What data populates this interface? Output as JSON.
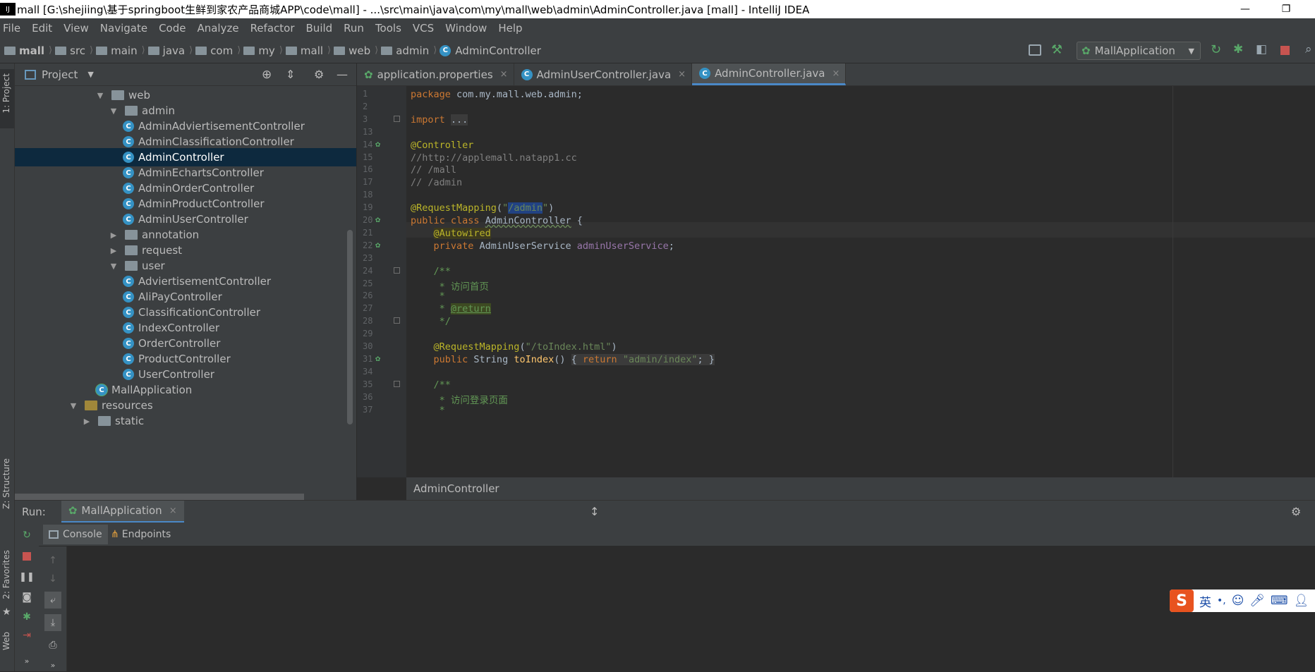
{
  "window": {
    "title": "mall [G:\\shejiing\\基于springboot生鲜到家农产品商城APP\\code\\mall] - ...\\src\\main\\java\\com\\my\\mall\\web\\admin\\AdminController.java [mall] - IntelliJ IDEA",
    "minimize": "—",
    "restore": "❐"
  },
  "menu": [
    "File",
    "Edit",
    "View",
    "Navigate",
    "Code",
    "Analyze",
    "Refactor",
    "Build",
    "Run",
    "Tools",
    "VCS",
    "Window",
    "Help"
  ],
  "breadcrumbs": [
    "mall",
    "src",
    "main",
    "java",
    "com",
    "my",
    "mall",
    "web",
    "admin",
    "AdminController"
  ],
  "run_config": "MallApplication",
  "tool_strip": {
    "project": "1: Project",
    "structure": "Z: Structure",
    "favorites": "2: Favorites",
    "web": "Web"
  },
  "project_panel": {
    "title": "Project",
    "tree": [
      {
        "label": "web",
        "type": "folder",
        "level": 1,
        "arrow": "▼"
      },
      {
        "label": "admin",
        "type": "folder",
        "level": 2,
        "arrow": "▼"
      },
      {
        "label": "AdminAdviertisementController",
        "type": "class",
        "level": 3
      },
      {
        "label": "AdminClassificationController",
        "type": "class",
        "level": 3
      },
      {
        "label": "AdminController",
        "type": "class",
        "level": 3,
        "selected": true
      },
      {
        "label": "AdminEchartsController",
        "type": "class",
        "level": 3
      },
      {
        "label": "AdminOrderController",
        "type": "class",
        "level": 3
      },
      {
        "label": "AdminProductController",
        "type": "class",
        "level": 3
      },
      {
        "label": "AdminUserController",
        "type": "class",
        "level": 3
      },
      {
        "label": "annotation",
        "type": "folder",
        "level": 2,
        "arrow": "▶"
      },
      {
        "label": "request",
        "type": "folder",
        "level": 2,
        "arrow": "▶"
      },
      {
        "label": "user",
        "type": "folder",
        "level": 2,
        "arrow": "▼"
      },
      {
        "label": "AdviertisementController",
        "type": "class",
        "level": 3
      },
      {
        "label": "AliPayController",
        "type": "class",
        "level": 3
      },
      {
        "label": "ClassificationController",
        "type": "class",
        "level": 3
      },
      {
        "label": "IndexController",
        "type": "class",
        "level": 3
      },
      {
        "label": "OrderController",
        "type": "class",
        "level": 3
      },
      {
        "label": "ProductController",
        "type": "class",
        "level": 3
      },
      {
        "label": "UserController",
        "type": "class",
        "level": 3
      },
      {
        "label": "MallApplication",
        "type": "app",
        "level": 1
      },
      {
        "label": "resources",
        "type": "resfolder",
        "level": -1,
        "arrow": "▼"
      },
      {
        "label": "static",
        "type": "folder",
        "level": 0,
        "arrow": "▶"
      }
    ]
  },
  "tabs": [
    {
      "label": "application.properties",
      "active": false
    },
    {
      "label": "AdminUserController.java",
      "active": false
    },
    {
      "label": "AdminController.java",
      "active": true
    }
  ],
  "tab_close": "×",
  "code_lines": [
    {
      "n": "1",
      "html": "<span class='k'>package</span> com.my.mall.web.admin;"
    },
    {
      "n": "2",
      "html": ""
    },
    {
      "n": "3",
      "html": "<span class='k'>import</span> <span style='background:#3b3b3b'>...</span>"
    },
    {
      "n": "13",
      "html": ""
    },
    {
      "n": "14",
      "html": "<span class='a'>@Controller</span>"
    },
    {
      "n": "15",
      "html": "<span class='c'>//http://applemall.natapp1.cc</span>"
    },
    {
      "n": "16",
      "html": "<span class='c'>// /mall</span>"
    },
    {
      "n": "17",
      "html": "<span class='c'>// /admin</span>"
    },
    {
      "n": "18",
      "html": ""
    },
    {
      "n": "19",
      "html": "<span class='a'>@RequestMapping</span>(<span class='s'>\"<span style='background:#214283'>/admin</span>\"</span>)"
    },
    {
      "n": "20",
      "html": "<span class='k'>public class</span> <span style='text-decoration:underline wavy #6a8759'>AdminController</span> {"
    },
    {
      "n": "21",
      "html": "    <span class='a' style='background:#3d3a1f'>@Autowired</span>"
    },
    {
      "n": "22",
      "html": "    <span class='k'>private</span> AdminUserService <span class='f'>adminUserService</span>;"
    },
    {
      "n": "23",
      "html": ""
    },
    {
      "n": "24",
      "html": "    <span class='d'>/**</span>"
    },
    {
      "n": "25",
      "html": "     <span class='d'>* 访问首页</span>"
    },
    {
      "n": "26",
      "html": "     <span class='d'>*</span>"
    },
    {
      "n": "27",
      "html": "     <span class='d'>* <span style='background:#3d4a22;text-decoration:underline'>@return</span></span>"
    },
    {
      "n": "28",
      "html": "     <span class='d'>*/</span>"
    },
    {
      "n": "29",
      "html": ""
    },
    {
      "n": "30",
      "html": "    <span class='a'>@RequestMapping</span>(<span class='s'>\"/toIndex.html\"</span>)"
    },
    {
      "n": "31",
      "html": "    <span class='k'>public</span> String <span class='m'>toIndex</span>() <span style='background:#3b3b3b'>{ <span class='k'>return</span> <span class='s'>\"admin/index\"</span>; }</span>"
    },
    {
      "n": "34",
      "html": ""
    },
    {
      "n": "35",
      "html": "    <span class='d'>/**</span>"
    },
    {
      "n": "36",
      "html": "     <span class='d'>* 访问登录页面</span>"
    },
    {
      "n": "37",
      "html": "     <span class='d'>*</span>"
    }
  ],
  "editor_breadcrumb": "AdminController",
  "run": {
    "label": "Run:",
    "config": "MallApplication",
    "close": "×",
    "tabs": [
      "Console",
      "Endpoints"
    ]
  },
  "ime": {
    "logo": "S",
    "lang": "英",
    "punct": "•,"
  }
}
